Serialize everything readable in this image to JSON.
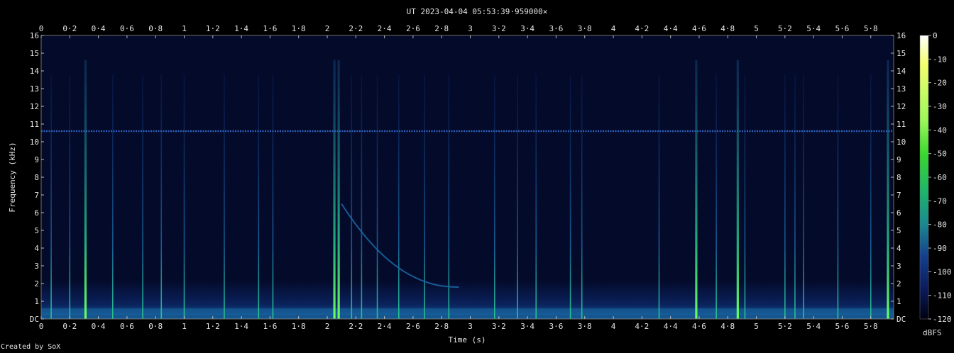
{
  "chart_data": {
    "type": "heatmap",
    "title": "UT 2023-04-04 05:53:39·959000×",
    "xlabel": "Time (s)",
    "ylabel": "Frequency (kHz)",
    "xlim": [
      0,
      5.96
    ],
    "ylim": [
      0,
      16
    ],
    "x_ticks": [
      "0",
      "0·2",
      "0·4",
      "0·6",
      "0·8",
      "1",
      "1·2",
      "1·4",
      "1·6",
      "1·8",
      "2",
      "2·2",
      "2·4",
      "2·6",
      "2·8",
      "3",
      "3·2",
      "3·4",
      "3·6",
      "3·8",
      "4",
      "4·2",
      "4·4",
      "4·6",
      "4·8",
      "5",
      "5·2",
      "5·4",
      "5·6",
      "5·8"
    ],
    "y_ticks": [
      "DC",
      "1",
      "2",
      "3",
      "4",
      "5",
      "6",
      "7",
      "8",
      "9",
      "10",
      "11",
      "12",
      "13",
      "14",
      "15",
      "16"
    ],
    "colorbar": {
      "label": "dBFS",
      "range": [
        -120,
        0
      ],
      "ticks": [
        "0",
        "-10",
        "-20",
        "-30",
        "-40",
        "-50",
        "-60",
        "-70",
        "-80",
        "-90",
        "-100",
        "-110",
        "-120"
      ]
    },
    "colors": {
      "background": "#000000",
      "floor": "#040a2a",
      "low": "#0c2a6e",
      "mid": "#1a6aa6",
      "high": "#27c78a",
      "peak": "#6cff5a",
      "hum_line": "#2d5fb8"
    },
    "features": {
      "hum_line_khz": 10.6,
      "spherics_s": [
        0.07,
        0.2,
        0.31,
        0.5,
        0.71,
        0.84,
        1.0,
        1.28,
        1.52,
        1.62,
        2.05,
        2.08,
        2.17,
        2.24,
        2.35,
        2.5,
        2.68,
        2.85,
        3.17,
        3.33,
        3.46,
        3.7,
        3.78,
        4.32,
        4.58,
        4.72,
        4.87,
        4.92,
        5.2,
        5.27,
        5.33,
        5.57,
        5.8,
        5.92
      ],
      "strong_spherics_s": [
        0.31,
        2.05,
        2.08,
        4.58,
        4.87,
        5.92
      ],
      "whistler": {
        "start_s": 2.1,
        "end_s": 2.92,
        "start_khz": 6.5,
        "end_khz": 1.8
      }
    }
  },
  "footer": {
    "credit": "Created by SoX"
  }
}
